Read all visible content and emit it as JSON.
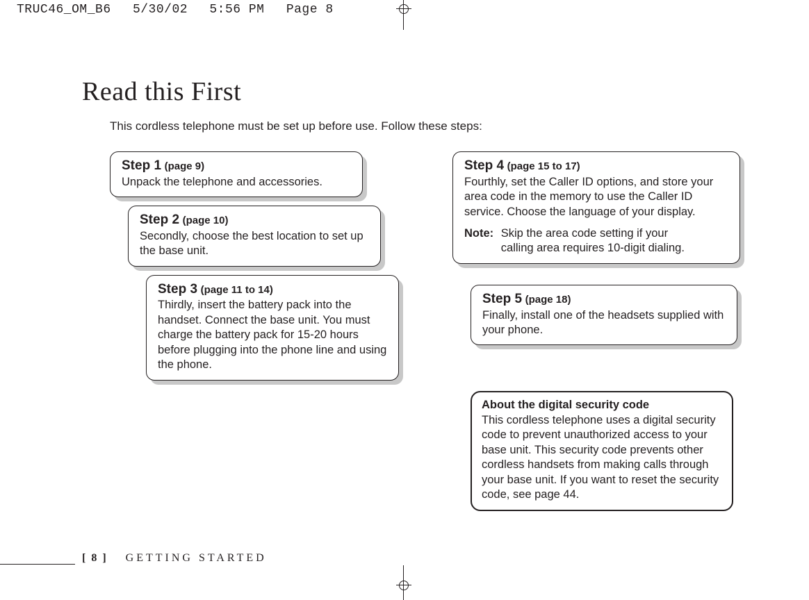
{
  "print_header": {
    "filename": "TRUC46_OM_B6",
    "date": "5/30/02",
    "time": "5:56 PM",
    "page_label": "Page 8"
  },
  "title": "Read this First",
  "intro": "This cordless telephone must be set up before use. Follow these steps:",
  "steps": {
    "s1": {
      "title": "Step 1",
      "pages": "(page 9)",
      "body": "Unpack the telephone and accessories."
    },
    "s2": {
      "title": "Step 2",
      "pages": "(page 10)",
      "body": "Secondly, choose the best location to set up the base unit."
    },
    "s3": {
      "title": "Step 3",
      "pages": "(page 11 to 14)",
      "body": "Thirdly, insert the battery pack into the handset. Connect the base unit. You must charge the battery pack for 15-20 hours before plugging into the phone line and using the phone."
    },
    "s4": {
      "title": "Step 4",
      "pages": "(page 15 to 17)",
      "body": "Fourthly, set the Caller ID options, and store your area code in the memory to use the Caller ID service. Choose the language of your display.",
      "note_label": "Note:",
      "note_body": "Skip the area code setting if your calling area requires 10-digit dialing."
    },
    "s5": {
      "title": "Step 5",
      "pages": "(page 18)",
      "body": "Finally, install one of the headsets supplied with your phone."
    }
  },
  "info": {
    "title": "About the digital security code",
    "body": "This cordless telephone uses a digital security code to prevent unauthorized access to your base unit. This security code prevents other cordless handsets from making calls through your base unit. If you want to reset the security code, see page 44."
  },
  "footer": {
    "page_num": "[ 8 ]",
    "section": "GETTING STARTED"
  }
}
